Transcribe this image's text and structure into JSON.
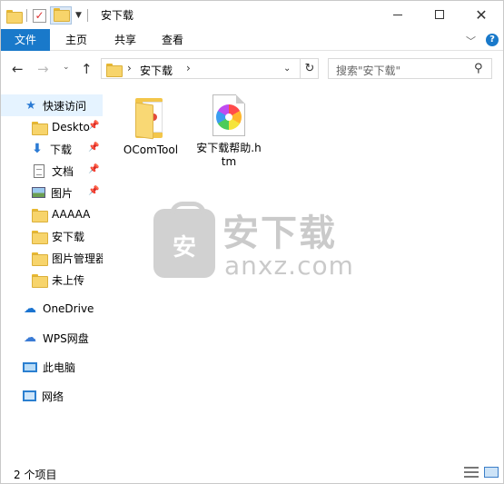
{
  "window": {
    "title": "安下载",
    "minimize_icon": "minimize-icon",
    "maximize_icon": "maximize-icon",
    "close_glyph": "✕"
  },
  "ribbon": {
    "tabs": [
      {
        "label": "文件",
        "active": true
      },
      {
        "label": "主页"
      },
      {
        "label": "共享"
      },
      {
        "label": "查看"
      }
    ],
    "expand_glyph": "﹀",
    "help_glyph": "?"
  },
  "nav": {
    "back_glyph": "←",
    "forward_glyph": "→",
    "recent_glyph": "⌄",
    "up_glyph": "↑",
    "breadcrumb": [
      "安下载"
    ],
    "chevron_glyph": "›",
    "dropdown_glyph": "⌄",
    "refresh_glyph": "↻",
    "search_placeholder": "搜索\"安下载\"",
    "search_glyph": "⚲"
  },
  "sidebar": {
    "quick_access": {
      "label": "快速访问",
      "icon": "star-icon"
    },
    "pinned": [
      {
        "label": "Deskto",
        "icon": "folder-icon",
        "pinned": true
      },
      {
        "label": "下载",
        "icon": "download-icon",
        "pinned": true
      },
      {
        "label": "文档",
        "icon": "document-icon",
        "pinned": true
      },
      {
        "label": "图片",
        "icon": "picture-icon",
        "pinned": true
      },
      {
        "label": "AAAAA",
        "icon": "folder-icon"
      },
      {
        "label": "安下载",
        "icon": "folder-icon"
      },
      {
        "label": "图片管理器",
        "icon": "folder-icon"
      },
      {
        "label": "未上传",
        "icon": "folder-icon"
      }
    ],
    "onedrive": "OneDrive",
    "wps": "WPS网盘",
    "this_pc": "此电脑",
    "network": "网络",
    "pin_glyph": "📌"
  },
  "files": [
    {
      "name": "OComTool",
      "type": "folder"
    },
    {
      "name": "安下载帮助.htm",
      "type": "htm"
    }
  ],
  "watermark": {
    "badge": "安",
    "cn": "安下载",
    "en": "anxz.com"
  },
  "status": {
    "count_text": "2 个项目"
  }
}
